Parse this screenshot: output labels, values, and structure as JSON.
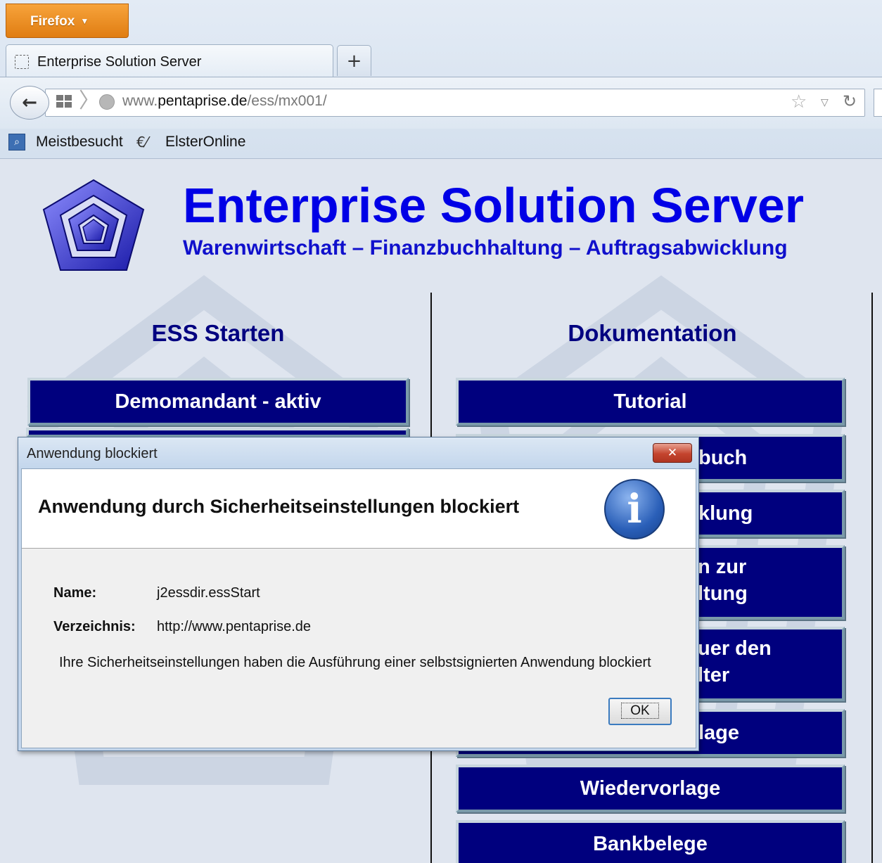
{
  "browser": {
    "menu_label": "Firefox",
    "tab_title": "Enterprise Solution Server",
    "new_tab_label": "+",
    "url_prefix": "www.",
    "url_domain": "pentaprise.de",
    "url_path": "/ess/mx001/",
    "bookmarks": [
      "Meistbesucht",
      "ElsterOnline"
    ]
  },
  "site": {
    "title": "Enterprise Solution Server",
    "subtitle": "Warenwirtschaft – Finanzbuchhaltung – Auftragsabwicklung",
    "left_heading": "ESS Starten",
    "right_heading": "Dokumentation",
    "left_buttons": [
      "Demomandant - aktiv"
    ],
    "right_buttons": [
      "Tutorial",
      "buch",
      "klung",
      "n zur\nltung",
      "uer den\nlter",
      "lage",
      "Wiedervorlage",
      "Bankbelege"
    ]
  },
  "dialog": {
    "window_title": "Anwendung blockiert",
    "close_label": "✕",
    "heading": "Anwendung durch Sicherheitseinstellungen blockiert",
    "info_glyph": "i",
    "name_label": "Name:",
    "name_value": "j2essdir.essStart",
    "dir_label": "Verzeichnis:",
    "dir_value": "http://www.pentaprise.de",
    "message": "Ihre Sicherheitseinstellungen haben die Ausführung einer selbstsignierten Anwendung blockiert",
    "ok_label": "OK"
  },
  "colors": {
    "button_bg": "#00007e",
    "title_blue": "#0000e6",
    "heading_navy": "#000080",
    "firefox_orange": "#e8891c"
  }
}
